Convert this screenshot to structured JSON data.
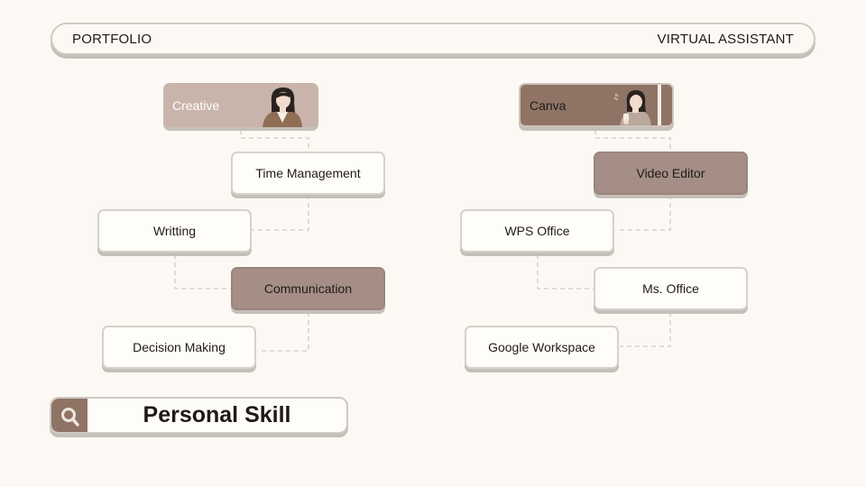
{
  "header": {
    "left_label": "PORTFOLIO",
    "right_label": "VIRTUAL ASSISTANT"
  },
  "left_tree": {
    "top": "Creative",
    "nodes": [
      "Time Management",
      "Writting",
      "Communication",
      "Decision Making"
    ]
  },
  "right_tree": {
    "top": "Canva",
    "nodes": [
      "Video Editor",
      "WPS Office",
      "Ms. Office",
      "Google Workspace"
    ]
  },
  "search": {
    "icon": "search-icon",
    "title": "Personal Skill"
  },
  "colors": {
    "background": "#fcf9f4",
    "accent_dark": "#8f7466",
    "accent_muted": "#a48e85",
    "accent_light": "#c9b4ab"
  }
}
